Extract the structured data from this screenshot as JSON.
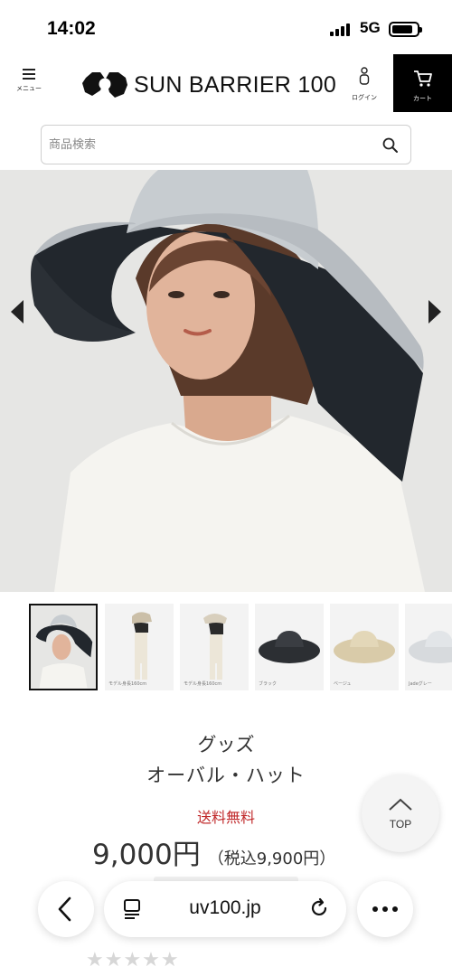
{
  "status_bar": {
    "time": "14:02",
    "network": "5G"
  },
  "header": {
    "menu_label": "メニュー",
    "logo_text": "SUN BARRIER 100",
    "login_label": "ログイン",
    "cart_label": "カート"
  },
  "search": {
    "placeholder": "商品検索"
  },
  "thumbnails": [
    {
      "caption": ""
    },
    {
      "caption": "モデル身長160cm"
    },
    {
      "caption": "モデル身長160cm"
    },
    {
      "caption": "ブラック"
    },
    {
      "caption": "ベージュ"
    },
    {
      "caption": "Jadeグレー"
    }
  ],
  "product": {
    "category": "グッズ",
    "name": "オーバル・ハット",
    "free_shipping": "送料無料",
    "price": "9,000円",
    "price_tax": "（税込9,900円）"
  },
  "top_button": {
    "label": "TOP"
  },
  "browser": {
    "url": "uv100.jp"
  },
  "colors": {
    "accent_red": "#c0282a",
    "cart_bg": "#000000"
  }
}
